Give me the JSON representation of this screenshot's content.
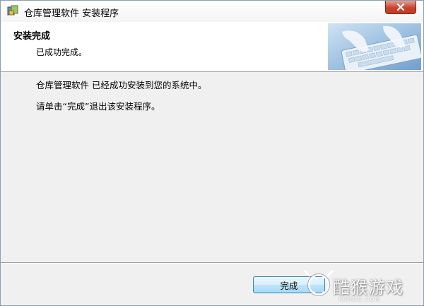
{
  "window": {
    "title": "仓库管理软件 安装程序"
  },
  "header": {
    "title": "安装完成",
    "subtitle": "已成功完成。"
  },
  "content": {
    "message_line1": "仓库管理软件   已经成功安装到您的系统中。",
    "message_line2": "请单击“完成”退出该安装程序。"
  },
  "buttons": {
    "finish_label": "完成"
  },
  "watermark": {
    "text": "酷猴游戏",
    "subtext": "KUHOU.COM"
  },
  "icons": {
    "app": "installer-app-icon",
    "close": "close-icon",
    "header_image": "keyboard-hands-image",
    "watermark_logo": "monkey-logo-icon"
  },
  "colors": {
    "close_button": "#c8452e",
    "window_bg": "#f0f0f0",
    "header_bg": "#ffffff",
    "finish_button_border": "#3c7fb1"
  }
}
